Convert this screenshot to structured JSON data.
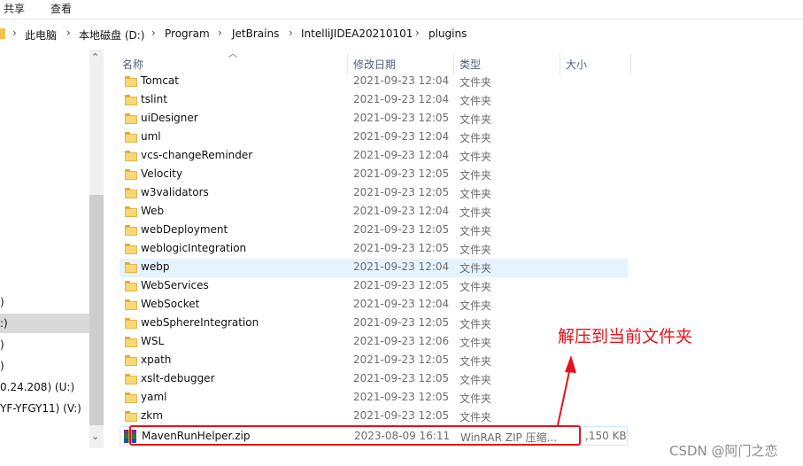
{
  "ribbon": {
    "tabs": [
      "共享",
      "查看"
    ]
  },
  "address": {
    "crumbs": [
      "此电脑",
      "本地磁盘 (D:)",
      "Program",
      "JetBrains",
      "IntelliJIDEA20210101",
      "plugins"
    ]
  },
  "nav": {
    "items": [
      ")",
      ":)",
      ")",
      ")",
      "0.24.208) (U:)",
      "YF-YFGY11) (V:)"
    ]
  },
  "columns": {
    "name": "名称",
    "date": "修改日期",
    "type": "类型",
    "size": "大小"
  },
  "files": [
    {
      "name": "Tomcat",
      "date": "2021-09-23 12:04",
      "type": "文件夹",
      "size": ""
    },
    {
      "name": "tslint",
      "date": "2021-09-23 12:04",
      "type": "文件夹",
      "size": ""
    },
    {
      "name": "uiDesigner",
      "date": "2021-09-23 12:05",
      "type": "文件夹",
      "size": ""
    },
    {
      "name": "uml",
      "date": "2021-09-23 12:04",
      "type": "文件夹",
      "size": ""
    },
    {
      "name": "vcs-changeReminder",
      "date": "2021-09-23 12:04",
      "type": "文件夹",
      "size": ""
    },
    {
      "name": "Velocity",
      "date": "2021-09-23 12:05",
      "type": "文件夹",
      "size": ""
    },
    {
      "name": "w3validators",
      "date": "2021-09-23 12:05",
      "type": "文件夹",
      "size": ""
    },
    {
      "name": "Web",
      "date": "2021-09-23 12:04",
      "type": "文件夹",
      "size": ""
    },
    {
      "name": "webDeployment",
      "date": "2021-09-23 12:05",
      "type": "文件夹",
      "size": ""
    },
    {
      "name": "weblogicIntegration",
      "date": "2021-09-23 12:05",
      "type": "文件夹",
      "size": ""
    },
    {
      "name": "webp",
      "date": "2021-09-23 12:04",
      "type": "文件夹",
      "size": ""
    },
    {
      "name": "WebServices",
      "date": "2021-09-23 12:05",
      "type": "文件夹",
      "size": ""
    },
    {
      "name": "WebSocket",
      "date": "2021-09-23 12:04",
      "type": "文件夹",
      "size": ""
    },
    {
      "name": "webSphereIntegration",
      "date": "2021-09-23 12:05",
      "type": "文件夹",
      "size": ""
    },
    {
      "name": "WSL",
      "date": "2021-09-23 12:06",
      "type": "文件夹",
      "size": ""
    },
    {
      "name": "xpath",
      "date": "2021-09-23 12:05",
      "type": "文件夹",
      "size": ""
    },
    {
      "name": "xslt-debugger",
      "date": "2021-09-23 12:05",
      "type": "文件夹",
      "size": ""
    },
    {
      "name": "yaml",
      "date": "2021-09-23 12:05",
      "type": "文件夹",
      "size": ""
    },
    {
      "name": "zkm",
      "date": "2021-09-23 12:05",
      "type": "文件夹",
      "size": ""
    },
    {
      "name": "MavenRunHelper.zip",
      "date": "2023-08-09 16:11",
      "type": "WinRAR ZIP 压缩...",
      "size": ",150 KB"
    }
  ],
  "annotation": {
    "text": "解压到当前文件夹",
    "color": "#e8121a"
  },
  "watermark": "CSDN @阿门之恋",
  "colors": {
    "folder": "#f8d775",
    "hover_row": "#e5f3ff",
    "header_text": "#4c607a"
  }
}
